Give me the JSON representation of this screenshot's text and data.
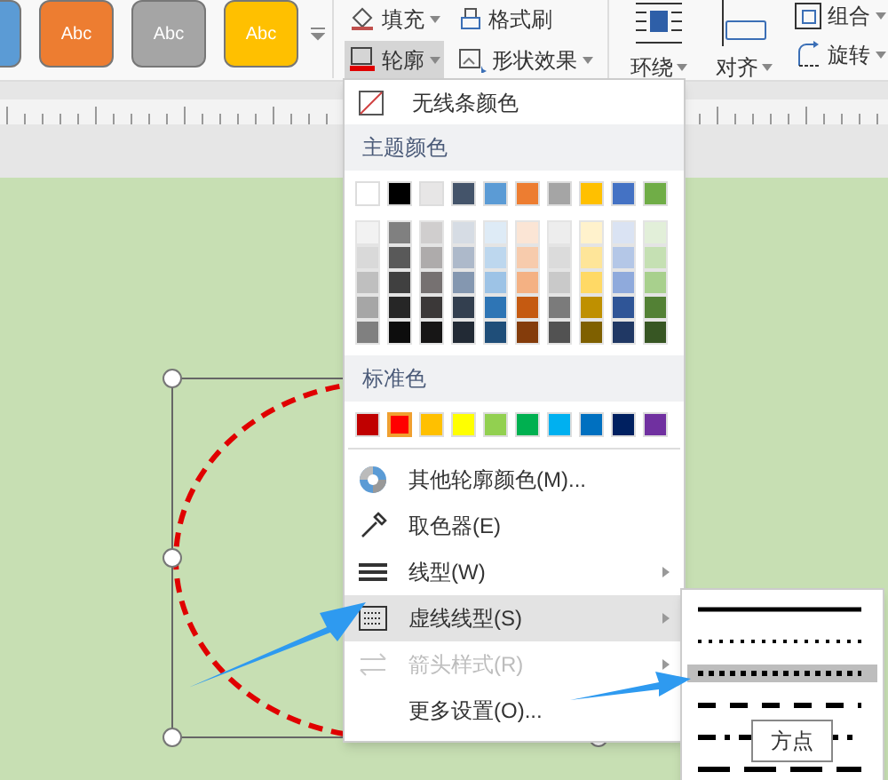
{
  "ribbon": {
    "styles": [
      {
        "color": "#5b9bd5"
      },
      {
        "label": "Abc",
        "color": "#ed7d31"
      },
      {
        "label": "Abc",
        "color": "#a5a5a5"
      },
      {
        "label": "Abc",
        "color": "#ffc000"
      }
    ],
    "tools": [
      {
        "label": "填充",
        "kind": "fill",
        "selected": false
      },
      {
        "label": "格式刷",
        "kind": "brush",
        "selected": false
      },
      {
        "label": "轮廓",
        "kind": "outline",
        "selected": true
      },
      {
        "label": "形状效果",
        "kind": "effects",
        "selected": false
      }
    ],
    "big_tools": [
      {
        "label": "环绕",
        "kind": "wrap"
      },
      {
        "label": "对齐",
        "kind": "align"
      }
    ],
    "small_tools": [
      {
        "label": "组合",
        "kind": "group"
      },
      {
        "label": "旋转",
        "kind": "rotate"
      }
    ]
  },
  "menu": {
    "no_line": "无线条颜色",
    "theme_header": "主题颜色",
    "theme_colors": [
      {
        "color": "#ffffff",
        "selected": false
      },
      {
        "color": "#000000",
        "selected": false
      },
      {
        "color": "#e7e6e6",
        "selected": false
      },
      {
        "color": "#44546a",
        "selected": false
      },
      {
        "color": "#5b9bd5",
        "selected": false
      },
      {
        "color": "#ed7d31",
        "selected": false
      },
      {
        "color": "#a5a5a5",
        "selected": false
      },
      {
        "color": "#ffc000",
        "selected": false
      },
      {
        "color": "#4472c4",
        "selected": false
      },
      {
        "color": "#70ad47",
        "selected": false
      }
    ],
    "shade_columns": [
      {
        "shades": [
          {
            "color": "#f2f2f2"
          },
          {
            "color": "#d9d9d9"
          },
          {
            "color": "#bfbfbf"
          },
          {
            "color": "#a6a6a6"
          },
          {
            "color": "#808080"
          }
        ]
      },
      {
        "shades": [
          {
            "color": "#808080"
          },
          {
            "color": "#595959"
          },
          {
            "color": "#404040"
          },
          {
            "color": "#262626"
          },
          {
            "color": "#0d0d0d"
          }
        ]
      },
      {
        "shades": [
          {
            "color": "#d0cece"
          },
          {
            "color": "#aeabab"
          },
          {
            "color": "#767171"
          },
          {
            "color": "#3b3838"
          },
          {
            "color": "#171616"
          }
        ]
      },
      {
        "shades": [
          {
            "color": "#d6dce4"
          },
          {
            "color": "#adb9ca"
          },
          {
            "color": "#8497b0"
          },
          {
            "color": "#333f4f"
          },
          {
            "color": "#222a35"
          }
        ]
      },
      {
        "shades": [
          {
            "color": "#deebf6"
          },
          {
            "color": "#bdd7ee"
          },
          {
            "color": "#9dc3e6"
          },
          {
            "color": "#2e75b5"
          },
          {
            "color": "#1f4e79"
          }
        ]
      },
      {
        "shades": [
          {
            "color": "#fbe5d5"
          },
          {
            "color": "#f7cbac"
          },
          {
            "color": "#f4b183"
          },
          {
            "color": "#c55a11"
          },
          {
            "color": "#843c0b"
          }
        ]
      },
      {
        "shades": [
          {
            "color": "#ededed"
          },
          {
            "color": "#dbdbdb"
          },
          {
            "color": "#c9c9c9"
          },
          {
            "color": "#7b7b7b"
          },
          {
            "color": "#525252"
          }
        ]
      },
      {
        "shades": [
          {
            "color": "#fff2cc"
          },
          {
            "color": "#fee599"
          },
          {
            "color": "#ffd965"
          },
          {
            "color": "#bf9000"
          },
          {
            "color": "#7f6000"
          }
        ]
      },
      {
        "shades": [
          {
            "color": "#dae3f3"
          },
          {
            "color": "#b4c7e7"
          },
          {
            "color": "#8faadc"
          },
          {
            "color": "#2f5597"
          },
          {
            "color": "#203864"
          }
        ]
      },
      {
        "shades": [
          {
            "color": "#e2efd9"
          },
          {
            "color": "#c5e0b3"
          },
          {
            "color": "#a8d08d"
          },
          {
            "color": "#538135"
          },
          {
            "color": "#375623"
          }
        ]
      }
    ],
    "standard_header": "标准色",
    "standard_colors": [
      {
        "color": "#c00000",
        "selected": false
      },
      {
        "color": "#ff0000",
        "selected": true
      },
      {
        "color": "#ffc000",
        "selected": false
      },
      {
        "color": "#ffff00",
        "selected": false
      },
      {
        "color": "#92d050",
        "selected": false
      },
      {
        "color": "#00b050",
        "selected": false
      },
      {
        "color": "#00b0f0",
        "selected": false
      },
      {
        "color": "#0070c0",
        "selected": false
      },
      {
        "color": "#002060",
        "selected": false
      },
      {
        "color": "#7030a0",
        "selected": false
      }
    ],
    "items": [
      {
        "label": "其他轮廓颜色(M)...",
        "kind": "palette",
        "submenu": false,
        "disabled": false,
        "selected": false
      },
      {
        "label": "取色器(E)",
        "kind": "picker",
        "submenu": false,
        "disabled": false,
        "selected": false
      },
      {
        "label": "线型(W)",
        "kind": "weight",
        "submenu": true,
        "disabled": false,
        "selected": false
      },
      {
        "label": "虚线线型(S)",
        "kind": "dash",
        "submenu": true,
        "disabled": false,
        "selected": true
      },
      {
        "label": "箭头样式(R)",
        "kind": "arrows",
        "submenu": true,
        "disabled": true,
        "selected": false
      },
      {
        "label": "更多设置(O)...",
        "kind": "none",
        "submenu": false,
        "disabled": false,
        "selected": false
      }
    ]
  },
  "dash_menu": {
    "styles": [
      {
        "kind": "solid",
        "selected": false
      },
      {
        "kind": "round-dot",
        "selected": false
      },
      {
        "kind": "square-dot",
        "selected": true
      },
      {
        "kind": "dash",
        "selected": false
      },
      {
        "kind": "dash-dot",
        "selected": false
      },
      {
        "kind": "long-dash",
        "selected": false
      }
    ],
    "tooltip": "方点"
  }
}
